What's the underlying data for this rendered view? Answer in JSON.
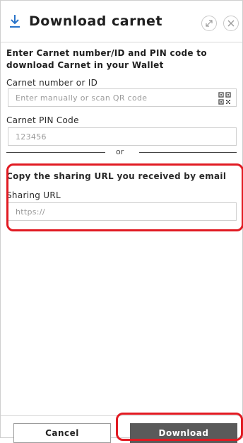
{
  "header": {
    "title": "Download carnet",
    "download_icon": "download-arrow-icon",
    "expand_icon": "expand-icon",
    "close_icon": "close-icon"
  },
  "intro_text": "Enter Carnet number/ID and PIN code to download Carnet in your Wallet",
  "carnet_number": {
    "label": "Carnet number or ID",
    "placeholder": "Enter manually or scan QR code",
    "icon": "qr-code-icon"
  },
  "pin": {
    "label": "Carnet PIN Code",
    "placeholder": "123456"
  },
  "separator": "or",
  "sharing": {
    "heading": "Copy the sharing URL you received by email",
    "label": "Sharing URL",
    "placeholder": "https://"
  },
  "footer": {
    "cancel_label": "Cancel",
    "download_label": "Download"
  },
  "colors": {
    "accent_blue": "#2a74c9",
    "highlight_red": "#e11a22",
    "download_button": "#5a5a5a"
  }
}
